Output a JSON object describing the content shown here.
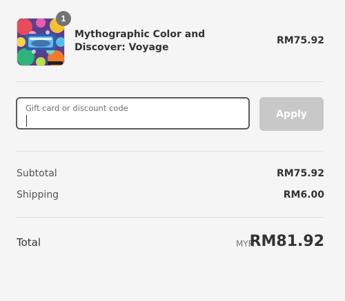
{
  "product": {
    "quantity": "1",
    "name": "Mythographic Color and Discover: Voyage",
    "price": "RM75.92",
    "thumbnail_alt": "Mythographic Color and Discover: Voyage book cover"
  },
  "discount": {
    "placeholder": "Gift card or discount code",
    "value": "",
    "apply_label": "Apply"
  },
  "summary": {
    "subtotal_label": "Subtotal",
    "subtotal_value": "RM75.92",
    "shipping_label": "Shipping",
    "shipping_value": "RM6.00",
    "total_label": "Total",
    "currency": "MYR",
    "total_value": "RM81.92"
  },
  "colors": {
    "background": "#f5f5f5",
    "text": "#333333",
    "muted_text": "#737373",
    "badge": "#737373",
    "apply_disabled": "#c8c8c8",
    "field_border": "#5a5a5a",
    "divider": "#dedede"
  }
}
